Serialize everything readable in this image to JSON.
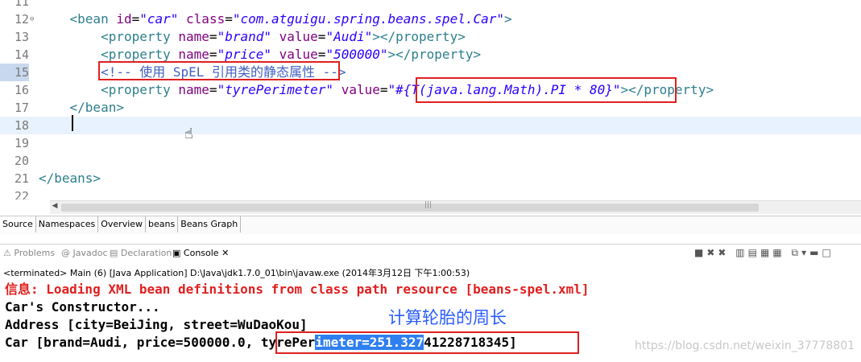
{
  "editor": {
    "lines": [
      {
        "num": "11",
        "parts": []
      },
      {
        "num": "12",
        "fold": "⊖",
        "parts": [
          {
            "t": "    <bean ",
            "c": "tag"
          },
          {
            "t": "id",
            "c": "attr"
          },
          {
            "t": "=",
            "c": ""
          },
          {
            "t": "\"car\"",
            "c": "val"
          },
          {
            "t": " class",
            "c": "attr"
          },
          {
            "t": "=",
            "c": ""
          },
          {
            "t": "\"com.atguigu.spring.beans.spel.Car\"",
            "c": "val"
          },
          {
            "t": ">",
            "c": "tag"
          }
        ]
      },
      {
        "num": "13",
        "parts": [
          {
            "t": "        <property ",
            "c": "tag"
          },
          {
            "t": "name",
            "c": "attr"
          },
          {
            "t": "=",
            "c": ""
          },
          {
            "t": "\"brand\"",
            "c": "val"
          },
          {
            "t": " value",
            "c": "attr"
          },
          {
            "t": "=",
            "c": ""
          },
          {
            "t": "\"Audi\"",
            "c": "val"
          },
          {
            "t": "></property>",
            "c": "tag"
          }
        ]
      },
      {
        "num": "14",
        "parts": [
          {
            "t": "        <property ",
            "c": "tag"
          },
          {
            "t": "name",
            "c": "attr"
          },
          {
            "t": "=",
            "c": ""
          },
          {
            "t": "\"price\"",
            "c": "val"
          },
          {
            "t": " value",
            "c": "attr"
          },
          {
            "t": "=",
            "c": ""
          },
          {
            "t": "\"500000\"",
            "c": "val"
          },
          {
            "t": "></property>",
            "c": "tag"
          }
        ]
      },
      {
        "num": "15",
        "parts": [
          {
            "t": "        <!-- 使用 SpEL 引用类的静态属性 -->",
            "c": "cmt"
          }
        ]
      },
      {
        "num": "16",
        "parts": [
          {
            "t": "        <property ",
            "c": "tag"
          },
          {
            "t": "name",
            "c": "attr"
          },
          {
            "t": "=",
            "c": ""
          },
          {
            "t": "\"tyrePerimeter\"",
            "c": "val"
          },
          {
            "t": " value",
            "c": "attr"
          },
          {
            "t": "=",
            "c": ""
          },
          {
            "t": "\"#{T(java.lang.Math).PI * 80}\"",
            "c": "val"
          },
          {
            "t": "></property>",
            "c": "tag"
          }
        ]
      },
      {
        "num": "17",
        "parts": [
          {
            "t": "    </bean>",
            "c": "tag"
          }
        ]
      },
      {
        "num": "18",
        "parts": []
      },
      {
        "num": "19",
        "parts": []
      },
      {
        "num": "20",
        "parts": []
      },
      {
        "num": "21",
        "parts": [
          {
            "t": "</beans>",
            "c": "tag"
          }
        ]
      },
      {
        "num": "22",
        "parts": []
      }
    ],
    "current_line": "18"
  },
  "editor_tabs": [
    "Source",
    "Namespaces",
    "Overview",
    "beans",
    "Beans Graph"
  ],
  "view_tabs": {
    "problems": "Problems",
    "javadoc": "Javadoc",
    "declaration": "Declaration",
    "console": "Console"
  },
  "console": {
    "terminated": "<terminated> Main (6) [Java Application] D:\\Java\\jdk1.7.0_01\\bin\\javaw.exe (2014年3月12日 下午1:00:53)",
    "line1": "信息: Loading XML bean definitions from class path resource [beans-spel.xml]",
    "line2": "Car's Constructor...",
    "line3": "Address [city=BeiJing, street=WuDaoKou]",
    "line4_a": "Car [brand=Audi, price=500000.0, tyrePer",
    "line4_sel": "imeter=251.327",
    "line4_b": "41228718345]",
    "note": "计算轮胎的周长"
  },
  "watermark": "https://blog.csdn.net/weixin_37778801",
  "colors": {
    "accent_red": "#e02020",
    "note_blue": "#2a5cff",
    "selection": "#2f7ff0"
  }
}
